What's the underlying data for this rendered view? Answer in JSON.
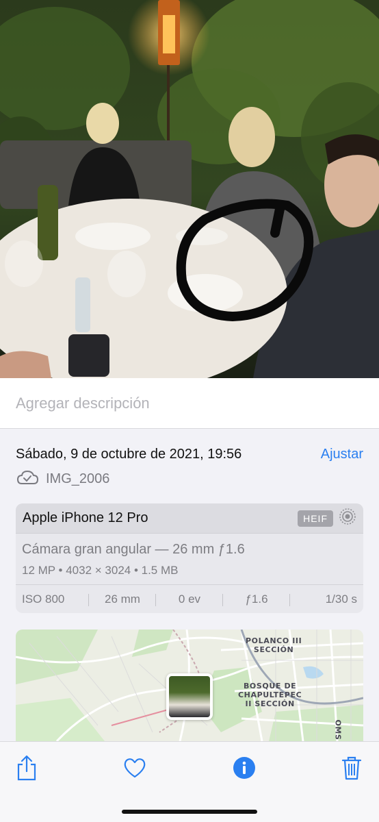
{
  "caption": {
    "placeholder": "Agregar descripción"
  },
  "info": {
    "date": "Sábado, 9 de octubre de 2021, 19:56",
    "adjust_label": "Ajustar",
    "filename": "IMG_2006",
    "device": "Apple iPhone 12 Pro",
    "format_badge": "HEIF",
    "lens": "Cámara gran angular — 26 mm ƒ1.6",
    "specs": "12 MP  •  4032 × 3024  •  1.5 MB",
    "exif": [
      "ISO 800",
      "26 mm",
      "0 ev",
      "ƒ1.6",
      "1/30 s"
    ]
  },
  "map": {
    "labels": [
      "POLANCO III\nSECCIÓN",
      "BOSQUE DE\nCHAPULTEPEC\nII SECCIÓN",
      "OMS"
    ]
  },
  "toolbar": {
    "icons": [
      "share-icon",
      "heart-icon",
      "info-icon",
      "trash-icon"
    ],
    "accent": "#2a7ff0"
  }
}
